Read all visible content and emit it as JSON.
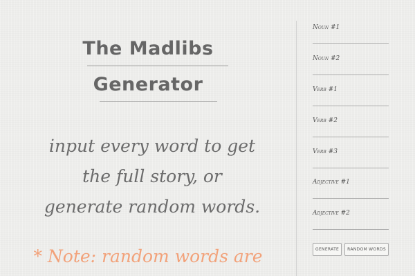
{
  "title": {
    "line1": "The Madlibs",
    "line2": "Generator"
  },
  "instructions": {
    "line1": "input every word to get",
    "line2": "the full story, or",
    "line3": "generate random words."
  },
  "note": "* Note: random words are",
  "fields": [
    {
      "label": "Noun #1",
      "value": ""
    },
    {
      "label": "Noun #2",
      "value": ""
    },
    {
      "label": "Verb #1",
      "value": ""
    },
    {
      "label": "Verb #2",
      "value": ""
    },
    {
      "label": "Verb #3",
      "value": ""
    },
    {
      "label": "Adjective #1",
      "value": ""
    },
    {
      "label": "Adjective #2",
      "value": ""
    }
  ],
  "buttons": {
    "generate": "Generate",
    "random_words": "Random Words"
  },
  "colors": {
    "background": "#ededeb",
    "text": "#666666",
    "note_accent": "#f2a27a"
  }
}
